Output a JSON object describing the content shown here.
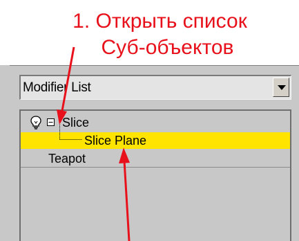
{
  "annotation": {
    "line_1": "1. Открыть список",
    "line_2": "Суб-объектов",
    "color": "#e8111b"
  },
  "modifier_dropdown": {
    "value": "Modifier List",
    "arrow_icon": "chevron-down-icon"
  },
  "stack": {
    "items": [
      {
        "label": "Slice",
        "icons": [
          "lightbulb-icon",
          "collapse-minus-icon"
        ],
        "expanded": true
      },
      {
        "label": "Slice Plane",
        "selected": true,
        "highlight_color": "#ffe400"
      },
      {
        "label": "Teapot"
      }
    ]
  },
  "colors": {
    "panel_background": "#c8c8c8",
    "selection_highlight": "#ffe400",
    "annotation_red": "#e8111b"
  }
}
